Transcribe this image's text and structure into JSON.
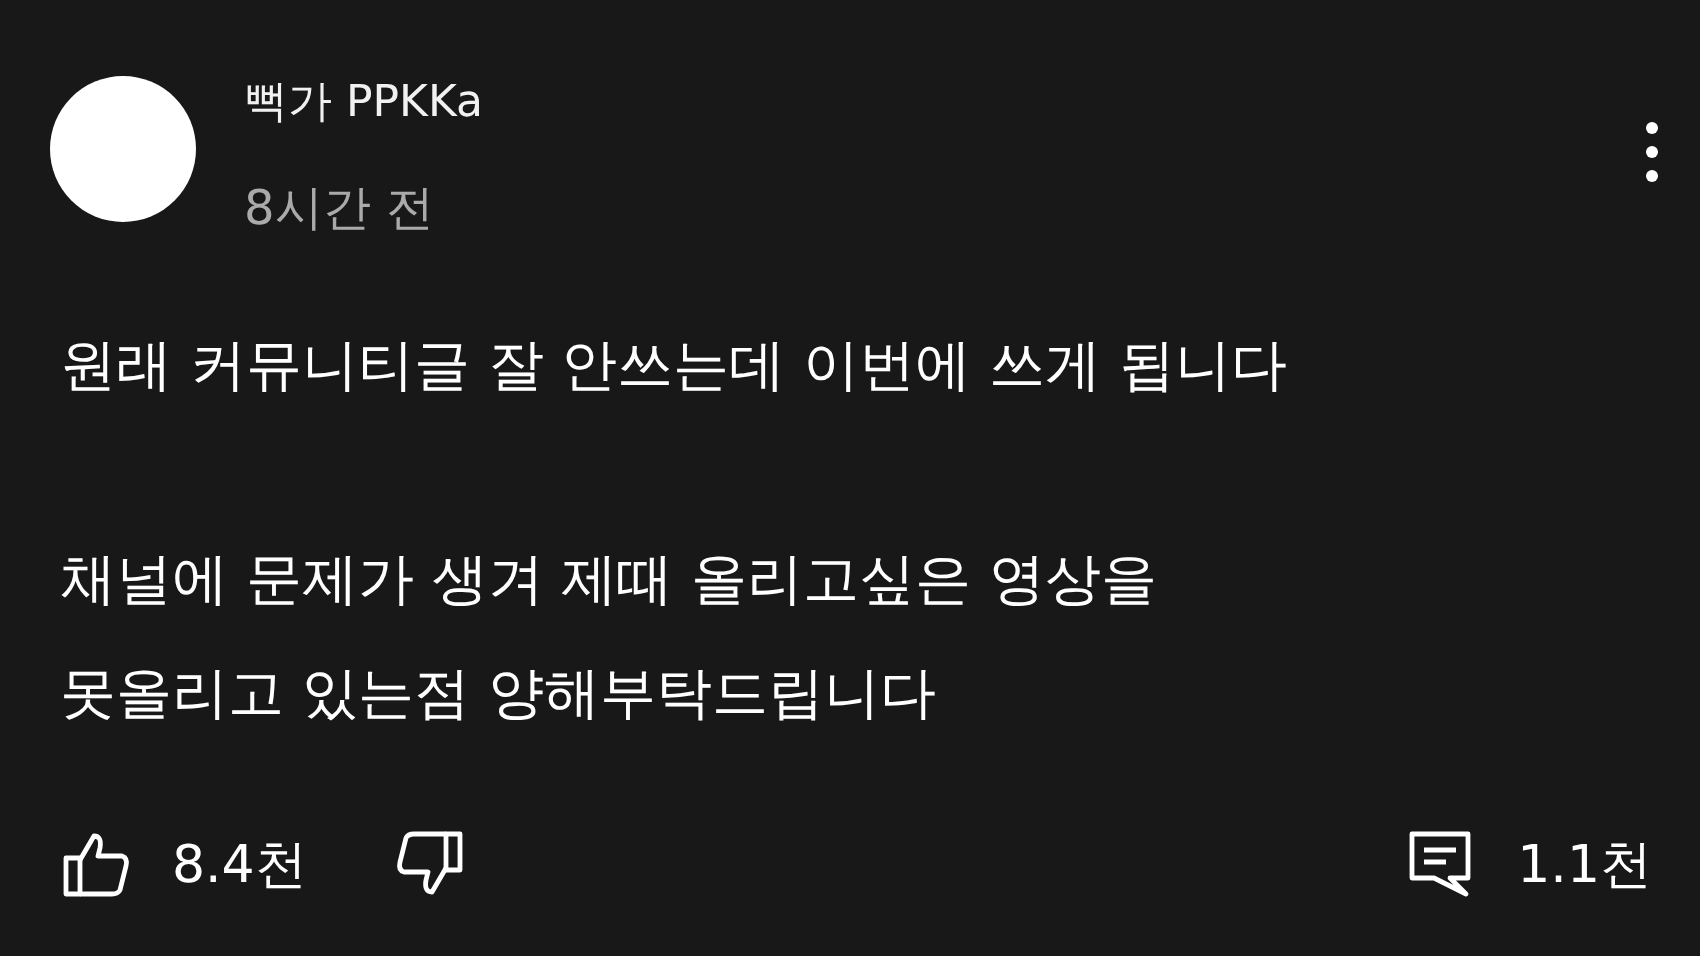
{
  "post": {
    "author": "뻑가 PPKKa",
    "time": "8시간 전",
    "paragraphs": [
      [
        "원래 커뮤니티글 잘 안쓰는데 이번에 쓰게 됩니다"
      ],
      [
        "채널에 문제가 생겨 제때 올리고싶은 영상을",
        "못올리고 있는점 양해부탁드립니다"
      ]
    ],
    "likes": "8.4천",
    "comments": "1.1천"
  }
}
